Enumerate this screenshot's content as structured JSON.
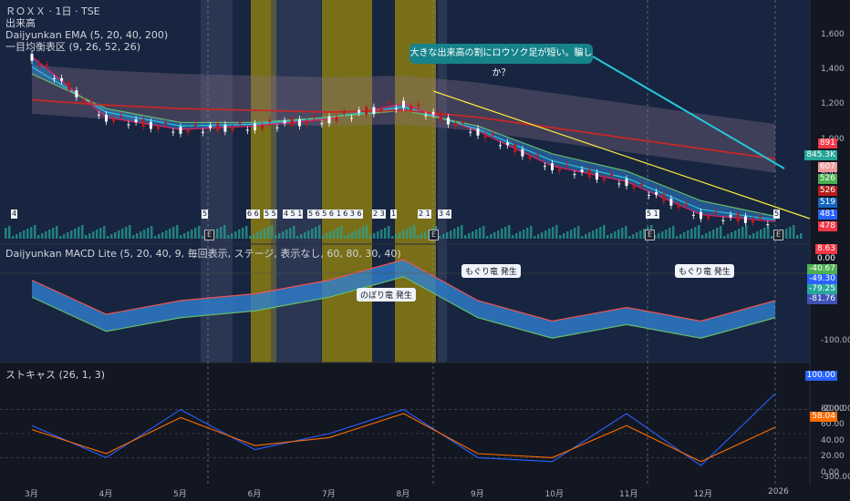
{
  "legend": {
    "symbol": "ＲＯＸＸ · 1日 · TSE",
    "volume": "出来高",
    "ema": "Daijyunkan EMA (5, 20, 40, 200)",
    "ichimoku": "一目均衡表区 (9, 26, 52, 26)",
    "macd": "Daijyunkan MACD Lite (5, 20, 40, 9, 毎回表示, ステージ, 表示なし, 60, 80, 30, 40)",
    "stoch": "ストキャス (26, 1, 3)"
  },
  "callout": "大きな出来高の割にロウソク足が短い。騙しか？",
  "bubbles": {
    "b1": "もぐり竜 発生",
    "b2": "もぐり竜 発生",
    "b3": "のぼり竜 発生"
  },
  "markers": [
    "4",
    "5",
    "6/6",
    "5/5",
    "4/5/1",
    "5/6/5/6/5/6/3/6",
    "1",
    "2/3",
    "1",
    "2/1",
    "3",
    "4",
    "5/1",
    "5"
  ],
  "marker_labels": [
    "4",
    "5",
    "6 6",
    "5 5",
    "4 5 1",
    "5 6 5 6 5 6 3 6",
    "1",
    "2 3",
    "1",
    "2 1",
    "3 4",
    "5 1",
    "5"
  ],
  "earnings": [
    "E",
    "E",
    "E",
    "E"
  ],
  "price_axis": [
    "1,600",
    "1,400",
    "1,200",
    "1,000",
    "800"
  ],
  "macd_axis": [
    "-100.00",
    "-200.00",
    "-300.00"
  ],
  "stoch_axis": [
    "80.00",
    "60.00",
    "40.00",
    "20.00",
    "0.00"
  ],
  "x_axis": [
    "3月",
    "4月",
    "5月",
    "6月",
    "7月",
    "8月",
    "9月",
    "10月",
    "11月",
    "12月",
    "2026"
  ],
  "price_tags": [
    {
      "text": "891",
      "color": "#f23645"
    },
    {
      "text": "845.3K",
      "color": "#26a69a"
    },
    {
      "text": "607",
      "color": "#ef9a9a"
    },
    {
      "text": "526",
      "color": "#4caf50"
    },
    {
      "text": "526",
      "color": "#b71c1c"
    },
    {
      "text": "519",
      "color": "#1565c0"
    },
    {
      "text": "481",
      "color": "#2962ff"
    },
    {
      "text": "478",
      "color": "#f23645"
    }
  ],
  "macd_tags": [
    {
      "text": "8.63",
      "color": "#f23645"
    },
    {
      "text": "0.00",
      "color": "#131722"
    },
    {
      "text": "-40.67",
      "color": "#4caf50"
    },
    {
      "text": "-49.30",
      "color": "#2962ff"
    },
    {
      "text": "-79.25",
      "color": "#26a69a"
    },
    {
      "text": "-81.76",
      "color": "#3f51b5"
    }
  ],
  "stoch_tags": [
    {
      "text": "100.00",
      "color": "#2962ff"
    },
    {
      "text": "58.04",
      "color": "#ff6d00"
    }
  ],
  "chart_data": {
    "type": "line",
    "x": [
      "3月",
      "4月",
      "5月",
      "6月",
      "7月",
      "8月",
      "9月",
      "10月",
      "11月",
      "12月",
      "2026"
    ],
    "series": [
      {
        "values": [
          1480,
          1130,
          1060,
          1080,
          1120,
          1210,
          1050,
          850,
          760,
          570,
          530
        ]
      },
      {
        "values": [
          1420,
          1160,
          1080,
          1090,
          1130,
          1190,
          1060,
          880,
          780,
          600,
          540
        ]
      },
      {
        "values": [
          1380,
          1180,
          1100,
          1100,
          1130,
          1170,
          1080,
          920,
          820,
          650,
          560
        ]
      },
      {
        "values": [
          1230,
          1200,
          1180,
          1170,
          1160,
          1170,
          1130,
          1070,
          1010,
          950,
          891
        ]
      }
    ],
    "ylim": [
      400,
      1700
    ],
    "macd": [
      -10,
      -60,
      -40,
      -30,
      -10,
      20,
      -40,
      -70,
      -50,
      -70,
      -40
    ],
    "stoch_k": [
      60,
      20,
      80,
      30,
      50,
      80,
      20,
      15,
      75,
      10,
      100
    ],
    "stoch_d": [
      55,
      25,
      70,
      35,
      45,
      75,
      25,
      20,
      60,
      15,
      58
    ]
  }
}
